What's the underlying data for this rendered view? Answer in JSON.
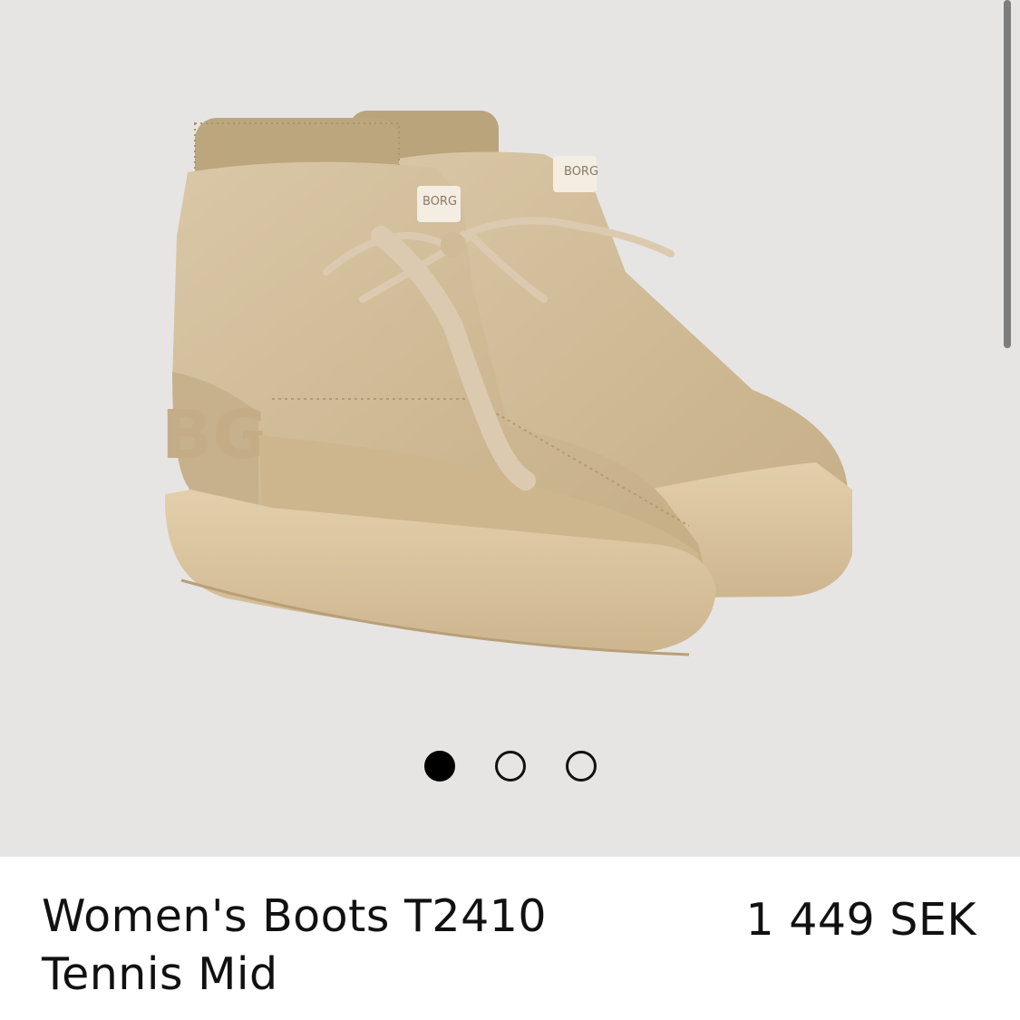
{
  "product": {
    "image_alt": "Beige lace-up boots with ribbed cuff and chunky sole",
    "brand_mark": "BORG",
    "title_line1": "Women's Boots T2410",
    "title_line2": "Tennis Mid",
    "price": "1 449 SEK"
  },
  "gallery": {
    "slide_count": 3,
    "active_index": 0
  },
  "colors": {
    "background": "#e6e5e3",
    "boot": "#d1bd98",
    "sole": "#dcc7a1",
    "text": "#111111"
  }
}
